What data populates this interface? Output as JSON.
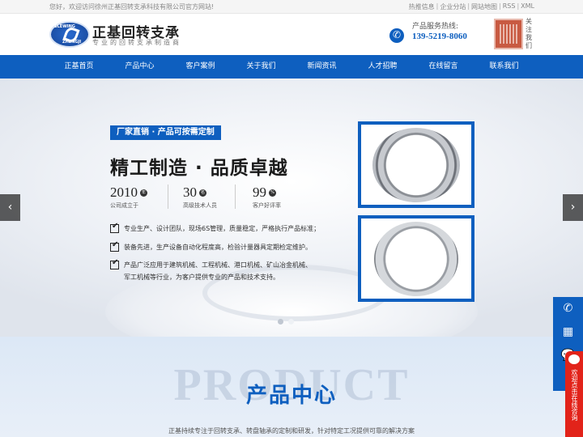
{
  "topbar": {
    "welcome": "您好，欢迎访问徐州正基回转支承科技有限公司官方网站!",
    "links": [
      "热推信息",
      "企业分站",
      "网站地图",
      "RSS",
      "XML"
    ]
  },
  "header": {
    "logo_top": "SLEWING",
    "logo_bottom": "ZHENGJI",
    "brand": "正基回转支承",
    "slogan": "专业的回转支承制造商",
    "hotline_label": "产品服务热线:",
    "hotline": "139-5219-8060",
    "follow": "关注我们"
  },
  "nav": [
    "正基首页",
    "产品中心",
    "客户案例",
    "关于我们",
    "新闻资讯",
    "人才招聘",
    "在线留言",
    "联系我们"
  ],
  "banner": {
    "tag": "厂家直销 · 产品可按需定制",
    "headline": "精工制造 · 品质卓越",
    "stats": [
      {
        "num": "2010",
        "unit": "年",
        "label": "公司成立于"
      },
      {
        "num": "30",
        "unit": "名",
        "label": "高级技术人员"
      },
      {
        "num": "99",
        "unit": "%",
        "label": "客户好评率"
      }
    ],
    "bullets": [
      "专业生产、设计团队，现场6S管理，质量稳定，严格执行产品标准；",
      "装备先进，生产设备自动化程度高，检验计量器具定期检定维护。",
      "产品广泛应用于建筑机械、工程机械、港口机械、矿山冶金机械、",
      "军工机械等行业，为客户提供专业的产品和技术支持。"
    ],
    "prev": "‹",
    "next": "›",
    "active_slide": 1,
    "slide_count": 2
  },
  "product": {
    "ghost": "PRODUCT",
    "title": "产品中心",
    "desc": "正基持续专注于回转支承、转盘轴承的定制和研发，针对特定工况提供可靠的解决方案"
  },
  "side": {
    "online": "欢迎点击在线咨询"
  }
}
